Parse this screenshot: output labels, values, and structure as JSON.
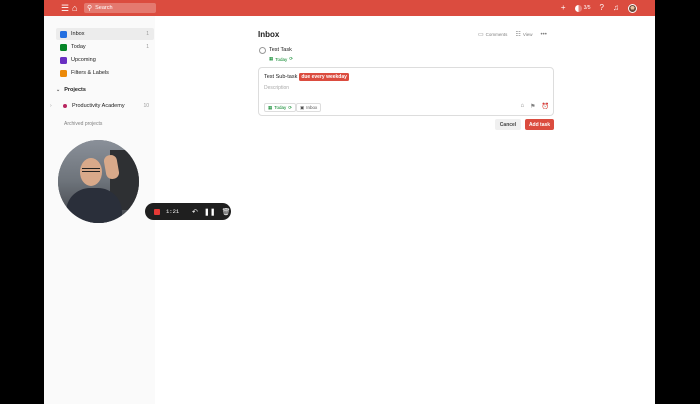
{
  "topbar": {
    "search_placeholder": "Search",
    "karma_label": "3/5",
    "icons": [
      "menu-icon",
      "home-icon",
      "search-icon",
      "add-icon",
      "karma-icon",
      "help-icon",
      "notifications-icon",
      "avatar"
    ],
    "color": "#db4c3f"
  },
  "sidebar": {
    "items": [
      {
        "label": "Inbox",
        "count": "1",
        "icon": "inbox-icon",
        "color": "#246fe0"
      },
      {
        "label": "Today",
        "count": "1",
        "icon": "today-icon",
        "color": "#058527"
      },
      {
        "label": "Upcoming",
        "count": "",
        "icon": "upcoming-icon",
        "color": "#692fc2"
      },
      {
        "label": "Filters & Labels",
        "count": "",
        "icon": "filters-icon",
        "color": "#eb8909"
      }
    ],
    "projects_heading": "Projects",
    "projects": [
      {
        "label": "Productivity Academy",
        "count": "10",
        "color": "#b8255f"
      }
    ],
    "archived_label": "Archived projects"
  },
  "recorder": {
    "time": "1:21",
    "icons": [
      "stop-icon",
      "undo-icon",
      "pause-icon",
      "trash-icon"
    ]
  },
  "main": {
    "title": "Inbox",
    "actions": [
      {
        "label": "Comments",
        "icon": "comment-icon"
      },
      {
        "label": "View",
        "icon": "view-icon"
      },
      {
        "label": "",
        "icon": "more-icon"
      }
    ],
    "task": {
      "name": "Test Task",
      "due": "Today"
    },
    "editor": {
      "title_text": "Test Sub-task",
      "highlight": "due every weekday",
      "description_placeholder": "Description",
      "due_chip": "Today",
      "project_chip": "Inbox"
    },
    "cancel_label": "Cancel",
    "add_label": "Add task"
  }
}
